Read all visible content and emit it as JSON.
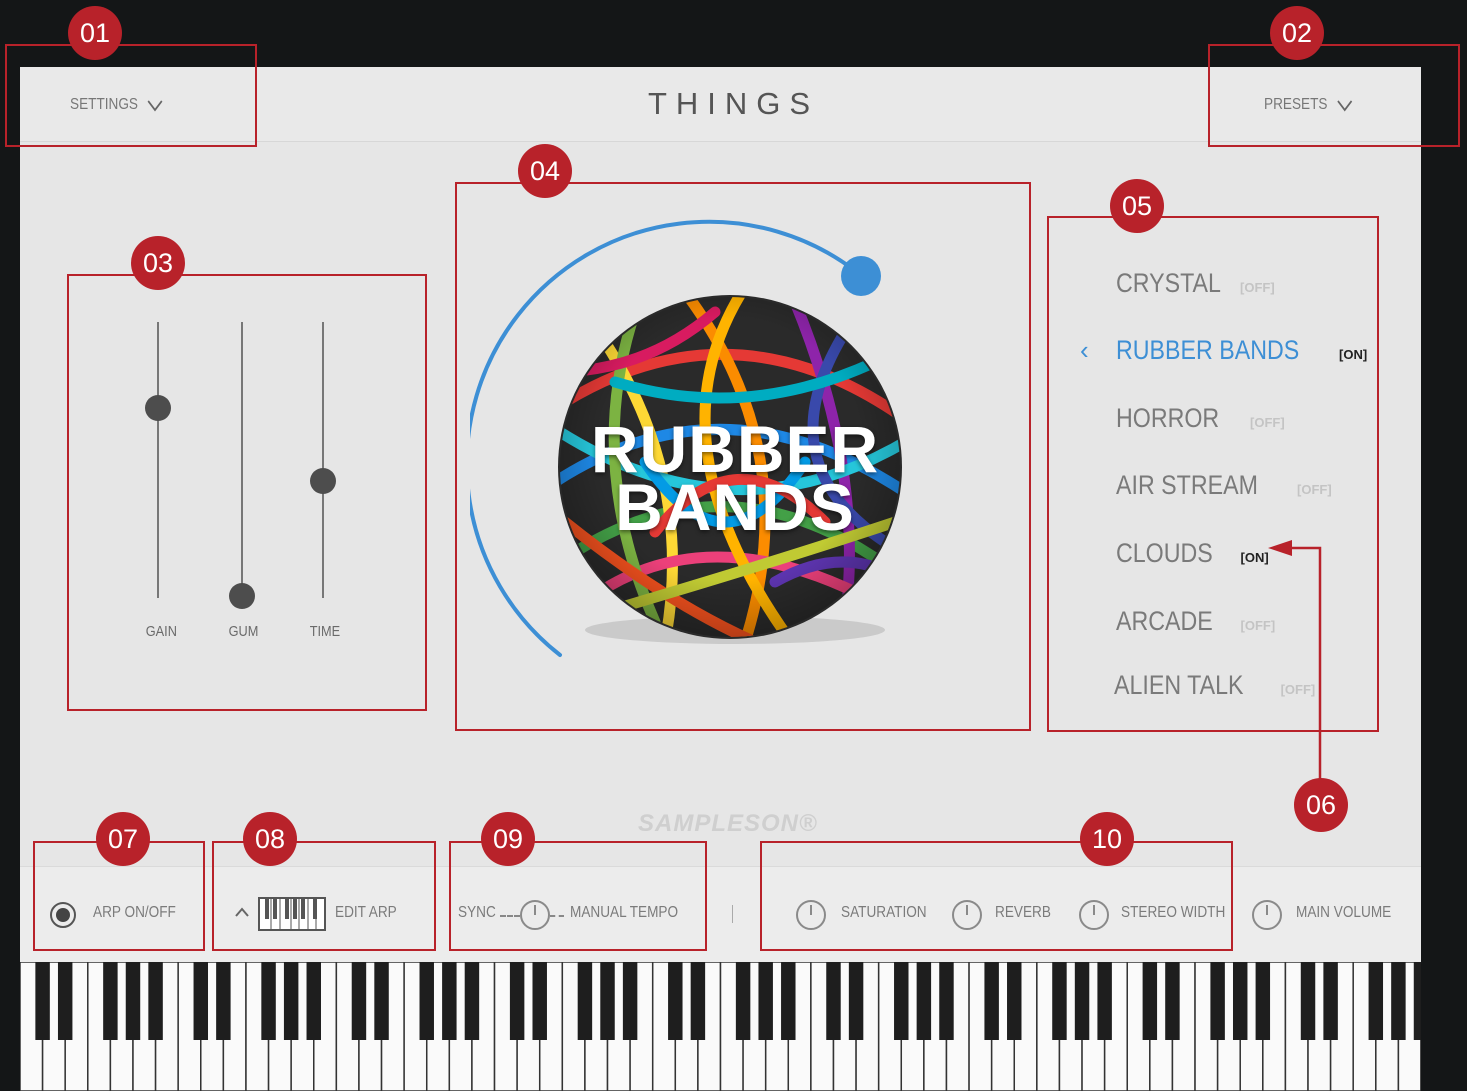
{
  "app": {
    "title": "THINGS",
    "brand": "SAMPLESON®",
    "accent_color": "#3d8fd5",
    "callout_color": "#b8222a"
  },
  "header": {
    "settings_label": "SETTINGS",
    "presets_label": "PRESETS"
  },
  "sliders": [
    {
      "label": "GAIN",
      "level": 0.73
    },
    {
      "label": "GUM",
      "level": 0.0
    },
    {
      "label": "TIME",
      "level": 0.42
    }
  ],
  "sound": {
    "name_line1": "RUBBER",
    "name_line2": "BANDS",
    "dial_level": 0.95
  },
  "presets": [
    {
      "name": "CRYSTAL",
      "state": "[OFF]",
      "active": false
    },
    {
      "name": "RUBBER BANDS",
      "state": "[ON]",
      "active": true
    },
    {
      "name": "HORROR",
      "state": "[OFF]",
      "active": false
    },
    {
      "name": "AIR STREAM",
      "state": "[OFF]",
      "active": false
    },
    {
      "name": "CLOUDS",
      "state": "[ON]",
      "active": false
    },
    {
      "name": "ARCADE",
      "state": "[OFF]",
      "active": false
    },
    {
      "name": "ALIEN TALK",
      "state": "[OFF]",
      "active": false
    }
  ],
  "bottom": {
    "arp_toggle_label": "ARP ON/OFF",
    "edit_arp_label": "EDIT ARP",
    "sync_label": "SYNC",
    "manual_tempo_label": "MANUAL TEMPO",
    "saturation_label": "SATURATION",
    "reverb_label": "REVERB",
    "stereo_width_label": "STEREO WIDTH",
    "main_volume_label": "MAIN VOLUME"
  },
  "callouts": [
    "01",
    "02",
    "03",
    "04",
    "05",
    "06",
    "07",
    "08",
    "09",
    "10"
  ]
}
